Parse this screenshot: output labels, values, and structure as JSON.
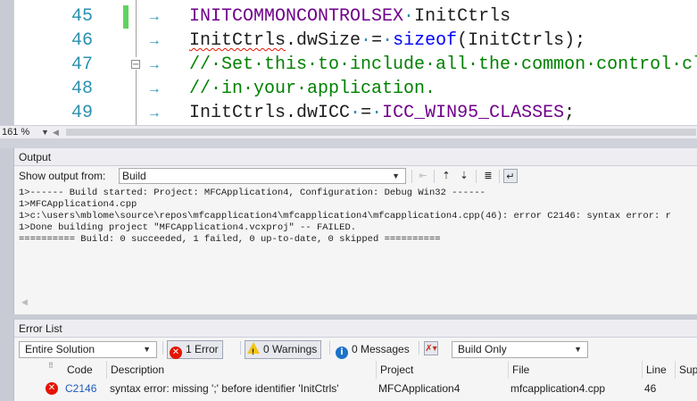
{
  "editor": {
    "lines": [
      {
        "num": "45",
        "segments": [
          {
            "t": "INITCOMMONCONTROLSEX",
            "c": "mac"
          },
          {
            "t": "·",
            "c": "dot"
          },
          {
            "t": "InitCtrls",
            "c": ""
          }
        ]
      },
      {
        "num": "46",
        "segments": [
          {
            "t": "InitCtrls",
            "c": "squiggle"
          },
          {
            "t": ".dwSize",
            "c": ""
          },
          {
            "t": "·",
            "c": "dot"
          },
          {
            "t": "=",
            "c": ""
          },
          {
            "t": "·",
            "c": "dot"
          },
          {
            "t": "sizeof",
            "c": "kw"
          },
          {
            "t": "(InitCtrls);",
            "c": ""
          }
        ]
      },
      {
        "num": "47",
        "segments": [
          {
            "t": "//·Set·this·to·include·all·the·common·control·clas",
            "c": "cm"
          }
        ]
      },
      {
        "num": "48",
        "segments": [
          {
            "t": "//·in·your·application.",
            "c": "cm"
          }
        ]
      },
      {
        "num": "49",
        "segments": [
          {
            "t": "InitCtrls",
            "c": ""
          },
          {
            "t": ".dwICC",
            "c": ""
          },
          {
            "t": "·",
            "c": "dot"
          },
          {
            "t": "=",
            "c": ""
          },
          {
            "t": "·",
            "c": "dot"
          },
          {
            "t": "ICC_WIN95_CLASSES",
            "c": "mac"
          },
          {
            "t": ";",
            "c": ""
          }
        ]
      }
    ],
    "tab_glyph": "→",
    "fold_glyph": "−",
    "zoom": "161 %",
    "colors": {
      "line_number": "#2b91af",
      "comment": "#008000",
      "keyword": "#0000ff",
      "macro": "#6f008a",
      "modified_bar": "#5fd35f"
    }
  },
  "output": {
    "title": "Output",
    "show_from_label": "Show output from:",
    "show_from_value": "Build",
    "lines": [
      "1>------ Build started: Project: MFCApplication4, Configuration: Debug Win32 ------",
      "1>MFCApplication4.cpp",
      "1>c:\\users\\mblome\\source\\repos\\mfcapplication4\\mfcapplication4\\mfcapplication4.cpp(46): error C2146: syntax error: r",
      "1>Done building project \"MFCApplication4.vcxproj\" -- FAILED.",
      "========== Build: 0 succeeded, 1 failed, 0 up-to-date, 0 skipped =========="
    ]
  },
  "error_list": {
    "title": "Error List",
    "scope": "Entire Solution",
    "errors_label": "1 Error",
    "warnings_label": "0 Warnings",
    "messages_label": "0 Messages",
    "build_filter": "Build Only",
    "columns": [
      "Code",
      "Description",
      "Project",
      "File",
      "Line",
      "Supp"
    ],
    "rows": [
      {
        "code": "C2146",
        "description": "syntax error: missing ';' before identifier 'InitCtrls'",
        "project": "MFCApplication4",
        "file": "mfcapplication4.cpp",
        "line": "46"
      }
    ],
    "colors": {
      "error": "#e51400",
      "info": "#1e72c8",
      "warning": "#f4c515",
      "code_link": "#1e5bb8"
    }
  }
}
